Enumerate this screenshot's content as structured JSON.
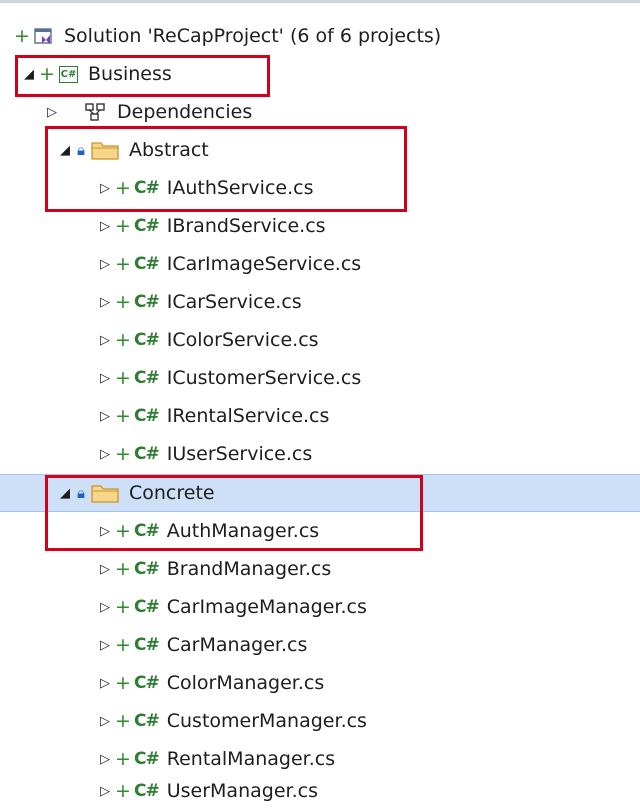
{
  "solution_explorer": {
    "solution": {
      "label": "Solution 'ReCapProject' (6 of 6 projects)",
      "icon": "solution-icon"
    },
    "project": {
      "label": "Business",
      "icon_text": "C#",
      "icon": "csharp-project-icon"
    },
    "dependencies": {
      "label": "Dependencies",
      "icon": "dependencies-icon"
    },
    "folders": [
      {
        "label": "Abstract",
        "icon": "folder-icon",
        "files": [
          "IAuthService.cs",
          "IBrandService.cs",
          "ICarImageService.cs",
          "ICarService.cs",
          "IColorService.cs",
          "ICustomerService.cs",
          "IRentalService.cs",
          "IUserService.cs"
        ]
      },
      {
        "label": "Concrete",
        "icon": "folder-icon",
        "files": [
          "AuthManager.cs",
          "BrandManager.cs",
          "CarImageManager.cs",
          "CarManager.cs",
          "ColorManager.cs",
          "CustomerManager.cs",
          "RentalManager.cs",
          "UserManager.cs"
        ]
      }
    ],
    "file_glyph": "C#",
    "selected_item": "Concrete",
    "colors": {
      "selection_bg": "#cde0f7",
      "annotation_red": "#d0021b",
      "csharp_green": "#2e7d32",
      "lock_blue": "#1f61c8",
      "folder_yellow": "#e8c06a"
    }
  }
}
